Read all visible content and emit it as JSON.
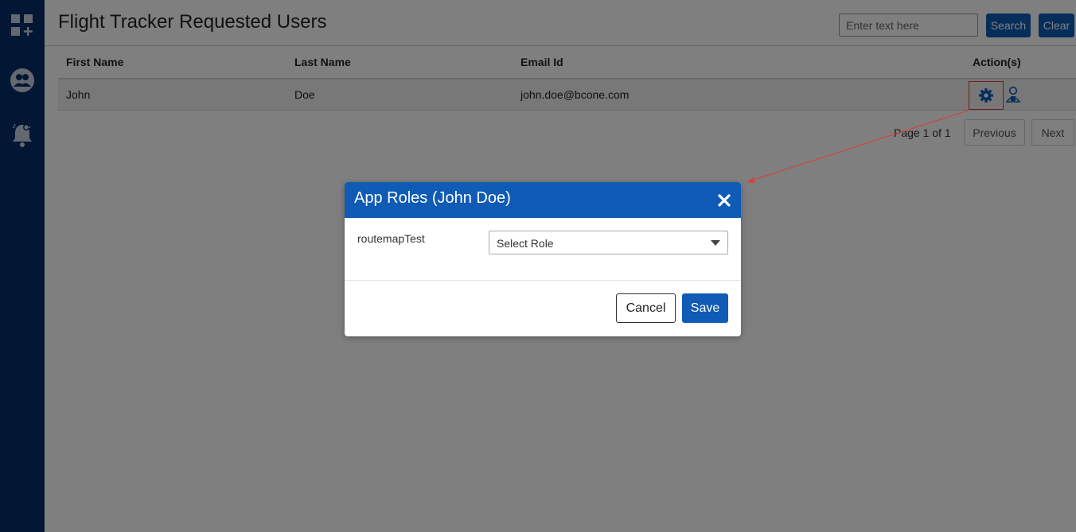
{
  "sidebar": {
    "items": [
      {
        "icon": "apps-add-icon"
      },
      {
        "icon": "users-group-icon"
      },
      {
        "icon": "notification-bell-icon"
      }
    ]
  },
  "header": {
    "title": "Flight Tracker Requested Users",
    "search_placeholder": "Enter text here",
    "search_value": "",
    "search_label": "Search",
    "clear_label": "Clear"
  },
  "table": {
    "columns": [
      "First Name",
      "Last Name",
      "Email Id",
      "Action(s)"
    ],
    "rows": [
      {
        "first_name": "John",
        "last_name": "Doe",
        "email": "john.doe@bcone.com"
      }
    ]
  },
  "pager": {
    "text": "Page 1 of 1",
    "previous_label": "Previous",
    "next_label": "Next"
  },
  "modal": {
    "title": "App Roles (John Doe)",
    "role_label": "routemapTest",
    "role_select_value": "Select Role",
    "cancel_label": "Cancel",
    "save_label": "Save"
  },
  "colors": {
    "sidebar": "#062f68",
    "accent": "#0f5bb5",
    "annotation": "#e23a3a"
  }
}
